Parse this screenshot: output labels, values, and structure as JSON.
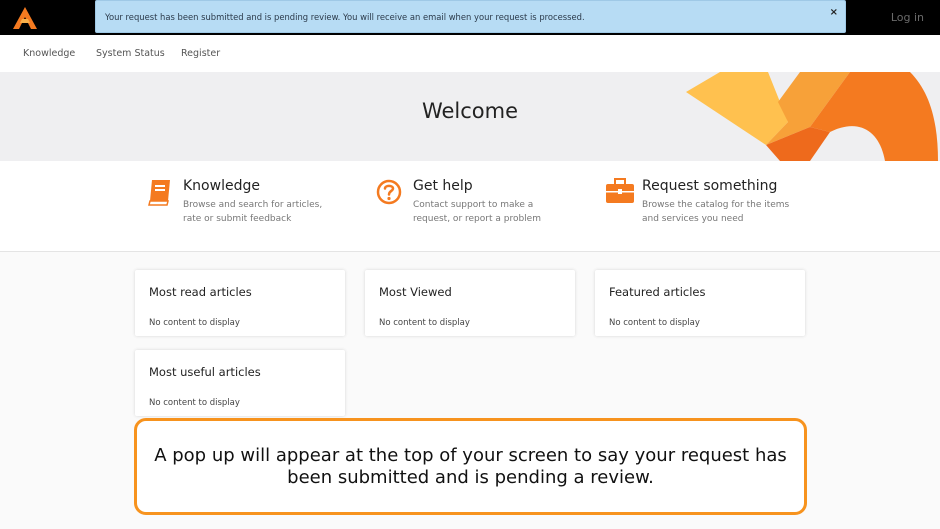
{
  "header": {
    "login_label": "Log in"
  },
  "alert": {
    "message": "Your request has been submitted and is pending review. You will receive an email when your request is processed.",
    "close_glyph": "×"
  },
  "nav": {
    "items": [
      {
        "label": "Knowledge"
      },
      {
        "label": "System Status"
      },
      {
        "label": "Register"
      }
    ]
  },
  "hero": {
    "title": "Welcome"
  },
  "features": [
    {
      "icon": "book-icon",
      "title": "Knowledge",
      "description": "Browse and search for articles, rate or submit feedback"
    },
    {
      "icon": "question-circle-icon",
      "title": "Get help",
      "description": "Contact support to make a request, or report a problem"
    },
    {
      "icon": "briefcase-icon",
      "title": "Request something",
      "description": "Browse the catalog for the items and services you need"
    }
  ],
  "cards": [
    {
      "title": "Most read articles",
      "empty_text": "No content to display"
    },
    {
      "title": "Most Viewed",
      "empty_text": "No content to display"
    },
    {
      "title": "Featured articles",
      "empty_text": "No content to display"
    },
    {
      "title": "Most useful articles",
      "empty_text": "No content to display"
    }
  ],
  "callout": {
    "text": "A pop up will appear at the top of your screen to say your request has been submitted and is pending a review."
  },
  "colors": {
    "accent_orange": "#f47a20",
    "alert_background": "#b7dcf4",
    "callout_border": "#f7931e"
  }
}
